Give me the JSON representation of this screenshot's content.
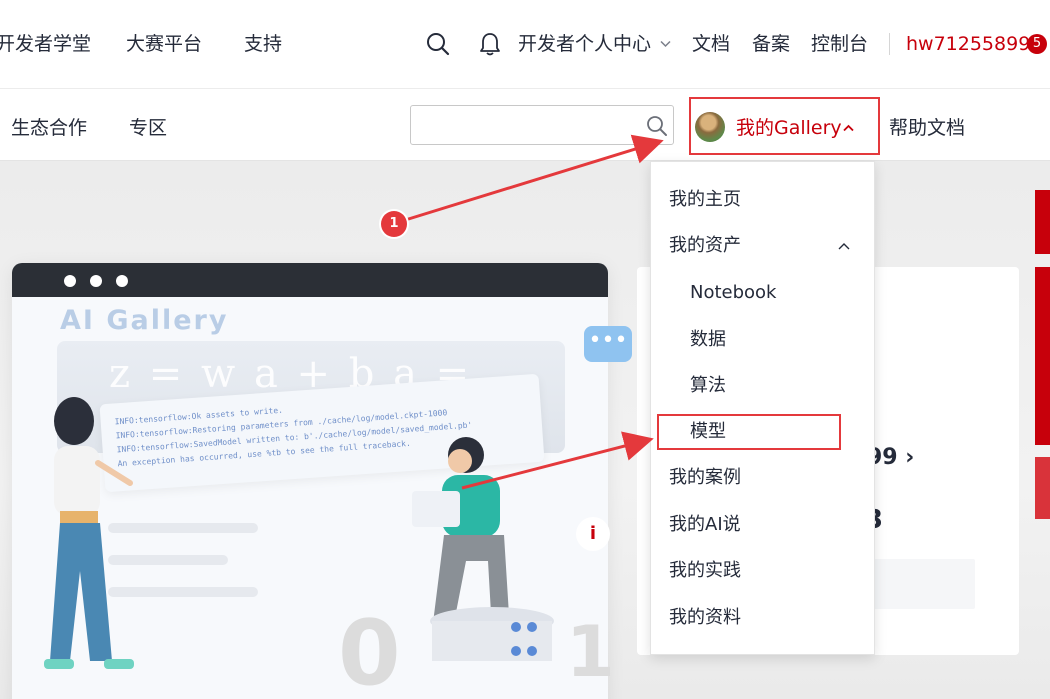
{
  "topnav": {
    "items": [
      "开发者学堂",
      "大赛平台",
      "支持"
    ],
    "dev_center": "开发者个人中心",
    "docs": "文档",
    "filing": "备案",
    "console": "控制台",
    "username": "hw71255899",
    "badge": "5",
    "icons": [
      "search-icon",
      "bell-icon",
      "chevron-down-icon"
    ]
  },
  "subnav": {
    "items": [
      "生态合作",
      "专区"
    ],
    "search_value": "",
    "gallery_label": "我的Gallery",
    "help": "帮助文档"
  },
  "hero": {
    "ai_title": "AI  Gallery",
    "formula": "z = w a  + b  a = σ(z)",
    "code_lines": [
      "INFO:tensorflow:Ok assets to write.",
      "INFO:tensorflow:Restoring parameters from ./cache/log/model.ckpt-1000",
      "INFO:tensorflow:SavedModel written to: b'./cache/log/model/saved_model.pb'",
      "An exception has occurred, use %tb to see the full traceback."
    ],
    "card_num1": "99",
    "card_num2": "3"
  },
  "dropdown": {
    "home": "我的主页",
    "assets": "我的资产",
    "assets_children": [
      "Notebook",
      "数据",
      "算法",
      "模型"
    ],
    "cases": "我的案例",
    "ai_talk": "我的AI说",
    "practice": "我的实践",
    "materials": "我的资料"
  },
  "annotation": {
    "step": "1"
  },
  "colors": {
    "brand_red": "#c7000b",
    "highlight_red": "#e4393c"
  }
}
